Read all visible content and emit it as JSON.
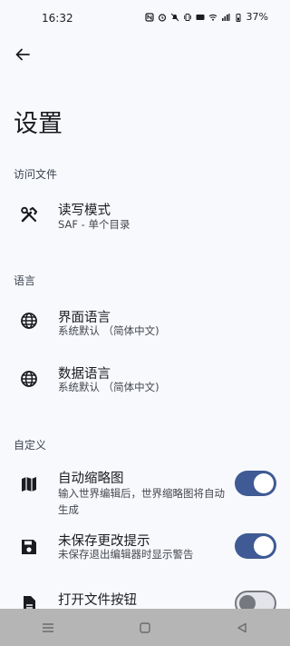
{
  "status": {
    "time": "16:32",
    "battery": "37%"
  },
  "title": "设置",
  "sections": {
    "file_access": {
      "header": "访问文件",
      "rw_mode_title": "读写模式",
      "rw_mode_summary": "SAF - 单个目录"
    },
    "language": {
      "header": "语言",
      "ui_lang_title": "界面语言",
      "ui_lang_summary": "系统默认 （简体中文)",
      "data_lang_title": "数据语言",
      "data_lang_summary": "系统默认 （简体中文)"
    },
    "custom": {
      "header": "自定义",
      "thumbnail_title": "自动缩略图",
      "thumbnail_summary": "输入世界编辑后，世界缩略图将自动生成",
      "unsaved_title": "未保存更改提示",
      "unsaved_summary": "未保存退出编辑器时显示警告",
      "open_file_title": "打开文件按钮"
    }
  },
  "toggles": {
    "thumbnail": true,
    "unsaved": true,
    "open_file": false
  },
  "icons": {
    "back": "arrow-left-icon",
    "rw_mode": "tools-icon",
    "ui_lang": "globe-icon",
    "data_lang": "globe-icon",
    "thumbnail": "map-icon",
    "unsaved": "save-icon",
    "open_file": "file-icon"
  }
}
